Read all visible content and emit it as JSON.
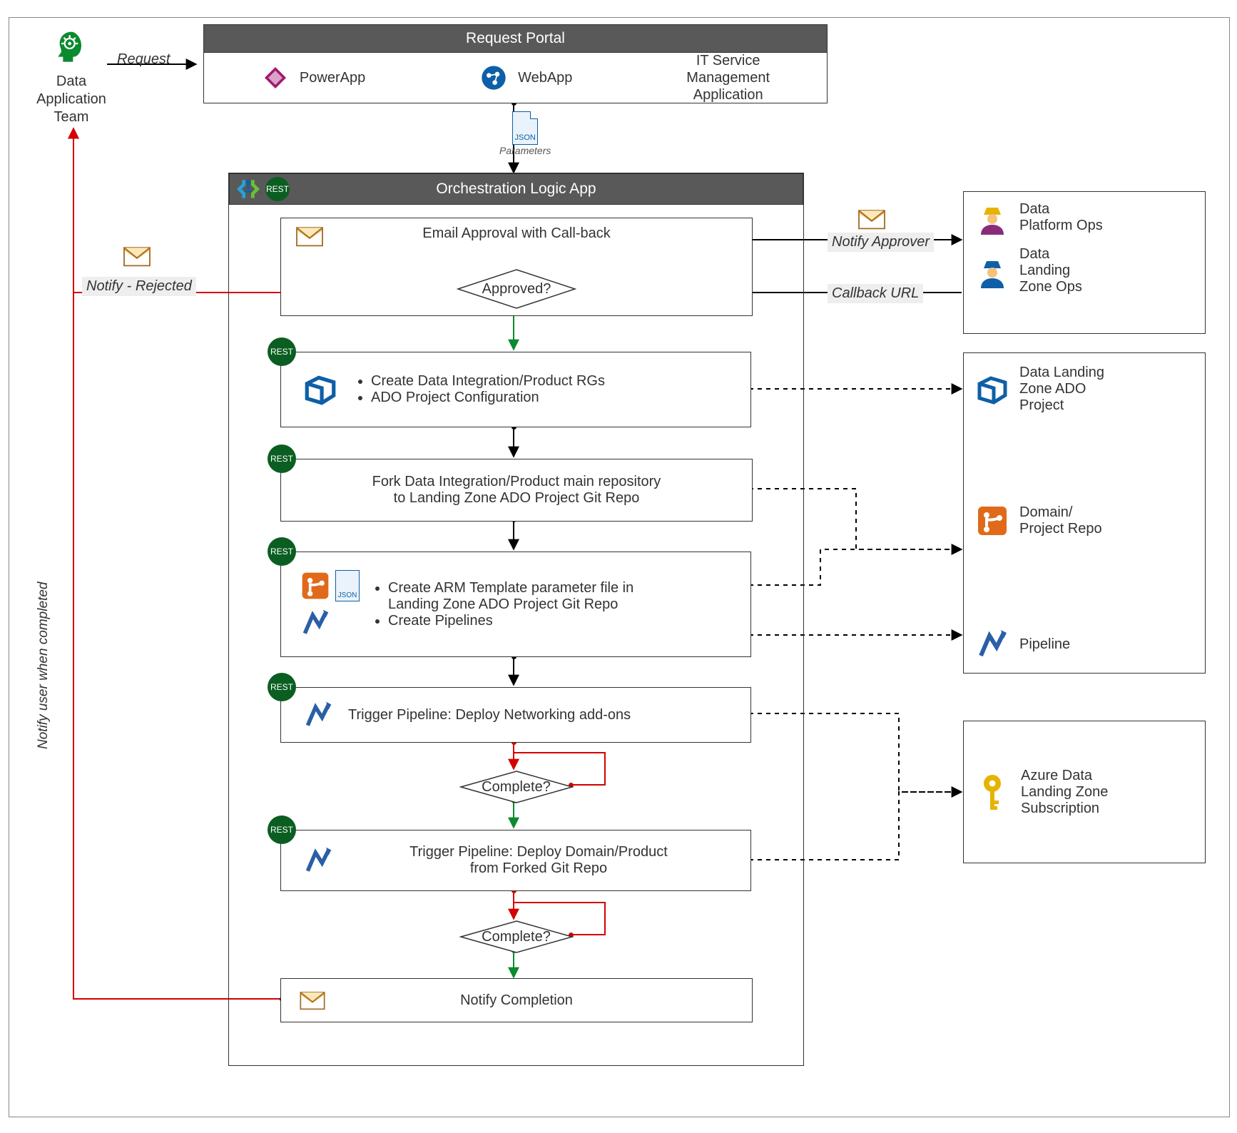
{
  "actors": {
    "dataAppTeam": "Data\nApplication\nTeam",
    "dataPlatformOps": "Data\nPlatform Ops",
    "dataLandingZoneOps": "Data\nLanding\nZone Ops"
  },
  "requestPortal": {
    "title": "Request Portal",
    "items": {
      "powerApp": "PowerApp",
      "webApp": "WebApp",
      "itsm": "IT Service\nManagement\nApplication"
    },
    "paramFile": "JSON",
    "paramLabel": "Parameters"
  },
  "orchestration": {
    "title": "Orchestration Logic App",
    "emailApproval": "Email Approval with Call-back",
    "approvedDecision": "Approved?",
    "step1": {
      "a": "Create Data Integration/Product RGs",
      "b": "ADO Project Configuration"
    },
    "step2": "Fork Data Integration/Product main repository\nto Landing Zone ADO Project Git Repo",
    "step3": {
      "a": "Create ARM Template parameter file in\nLanding Zone ADO Project Git Repo",
      "b": "Create Pipelines"
    },
    "step4": "Trigger Pipeline: Deploy Networking add-ons",
    "complete1": "Complete?",
    "step5": "Trigger Pipeline: Deploy Domain/Product\nfrom Forked Git Repo",
    "complete2": "Complete?",
    "notify": "Notify Completion"
  },
  "edges": {
    "request": "Request",
    "notifyRejected": "Notify - Rejected",
    "notifyApprover": "Notify Approver",
    "callbackUrl": "Callback URL",
    "notifyCompleted": "Notify user when completed"
  },
  "rightBoxes": {
    "adoProject": "Data Landing\nZone ADO\nProject",
    "domainRepo": "Domain/\nProject Repo",
    "pipeline": "Pipeline",
    "subscription": "Azure Data\nLanding Zone\nSubscription"
  },
  "rest": "REST"
}
